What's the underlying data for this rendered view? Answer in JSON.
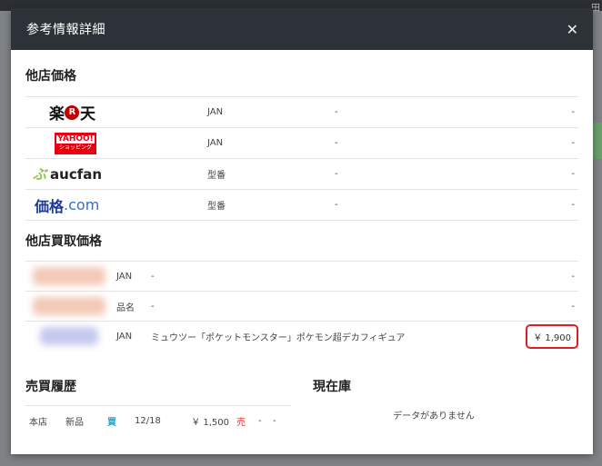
{
  "background": {
    "top_right_text": "田"
  },
  "modal": {
    "title": "参考情報詳細",
    "close_icon": "✕"
  },
  "competitor_prices": {
    "title": "他店価格",
    "rows": [
      {
        "store": "rakuten",
        "logo_text": [
          "楽",
          "R",
          "天"
        ],
        "key": "JAN",
        "name": "-",
        "price": "-"
      },
      {
        "store": "yahoo",
        "logo_text": [
          "YAHOO!",
          "ショッピング"
        ],
        "key": "JAN",
        "name": "-",
        "price": "-"
      },
      {
        "store": "aucfan",
        "logo_text": [
          "aucfan"
        ],
        "key": "型番",
        "name": "-",
        "price": "-"
      },
      {
        "store": "kakaku",
        "logo_text": [
          "価格",
          ".com"
        ],
        "key": "型番",
        "name": "-",
        "price": "-"
      }
    ]
  },
  "competitor_buy_prices": {
    "title": "他店買取価格",
    "rows": [
      {
        "key": "JAN",
        "name": "-",
        "price": "-"
      },
      {
        "key": "品名",
        "name": "-",
        "price": "-"
      },
      {
        "key": "JAN",
        "name": "ミュウツー「ポケットモンスター」ポケモン超デカフィギュア",
        "price": "￥ 1,900"
      }
    ]
  },
  "sales_history": {
    "title": "売買履歴",
    "rows": [
      {
        "store": "本店",
        "condition": "新品",
        "type": "買",
        "date": "12/18",
        "price": "￥ 1,500",
        "sell": "売",
        "c1": "-",
        "c2": "-"
      }
    ]
  },
  "inventory": {
    "title": "現在庫",
    "empty_message": "データがありません"
  },
  "colors": {
    "header_bg": "#2d3238",
    "highlight": "#e02020",
    "buy": "#2aa3c7",
    "sell": "#e03030"
  }
}
